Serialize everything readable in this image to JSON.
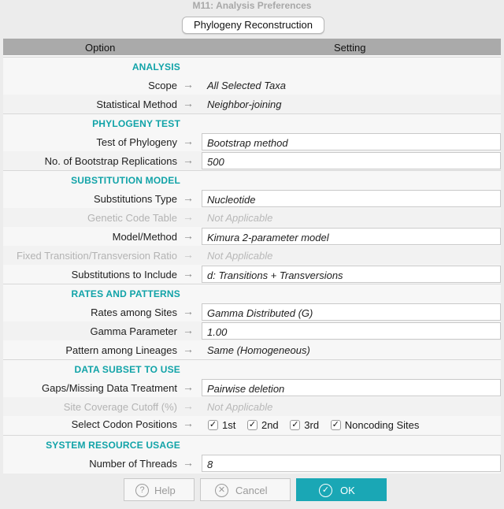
{
  "window": {
    "title": "M11: Analysis Preferences"
  },
  "tab": {
    "label": "Phylogeny Reconstruction"
  },
  "columns": {
    "option": "Option",
    "setting": "Setting"
  },
  "sections": {
    "analysis": "ANALYSIS",
    "phylogeny_test": "PHYLOGENY TEST",
    "substitution_model": "SUBSTITUTION MODEL",
    "rates_patterns": "RATES AND PATTERNS",
    "data_subset": "DATA SUBSET TO USE",
    "system_resource": "SYSTEM RESOURCE USAGE"
  },
  "arrow_glyph": "→",
  "rows": {
    "scope": {
      "label": "Scope",
      "value": "All Selected Taxa"
    },
    "statistical_method": {
      "label": "Statistical Method",
      "value": "Neighbor-joining"
    },
    "test_of_phylogeny": {
      "label": "Test of Phylogeny",
      "value": "Bootstrap method"
    },
    "bootstrap_replications": {
      "label": "No. of Bootstrap Replications",
      "value": "500"
    },
    "substitutions_type": {
      "label": "Substitutions Type",
      "value": "Nucleotide"
    },
    "genetic_code_table": {
      "label": "Genetic Code Table",
      "value": "Not Applicable"
    },
    "model_method": {
      "label": "Model/Method",
      "value": "Kimura 2-parameter model"
    },
    "fixed_ratio": {
      "label": "Fixed Transition/Transversion Ratio",
      "value": "Not Applicable"
    },
    "substitutions_include": {
      "label": "Substitutions to Include",
      "value": "d: Transitions + Transversions"
    },
    "rates_among_sites": {
      "label": "Rates among Sites",
      "value": "Gamma Distributed (G)"
    },
    "gamma_parameter": {
      "label": "Gamma Parameter",
      "value": "1.00"
    },
    "pattern_lineages": {
      "label": "Pattern among Lineages",
      "value": "Same (Homogeneous)"
    },
    "gaps_missing": {
      "label": "Gaps/Missing Data Treatment",
      "value": "Pairwise deletion"
    },
    "site_coverage": {
      "label": "Site Coverage Cutoff (%)",
      "value": "Not Applicable"
    },
    "codon_positions": {
      "label": "Select Codon Positions"
    },
    "threads": {
      "label": "Number of Threads",
      "value": "8"
    }
  },
  "codons": {
    "check_glyph": "✓",
    "first": {
      "label": "1st",
      "checked": true
    },
    "second": {
      "label": "2nd",
      "checked": true
    },
    "third": {
      "label": "3rd",
      "checked": true
    },
    "noncoding": {
      "label": "Noncoding Sites",
      "checked": true
    }
  },
  "buttons": {
    "help": {
      "label": "Help",
      "icon": "?"
    },
    "cancel": {
      "label": "Cancel",
      "icon": "✕"
    },
    "ok": {
      "label": "OK",
      "icon": "✓"
    }
  },
  "colors": {
    "accent": "#11a3a8",
    "ok_button": "#1aa7b5",
    "header_bar": "#aaaaaa"
  }
}
